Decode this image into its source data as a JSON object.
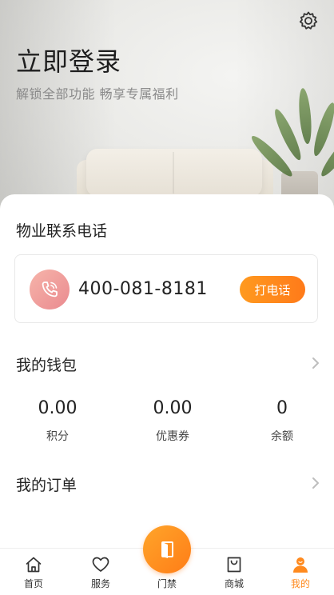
{
  "header": {
    "title": "立即登录",
    "subtitle": "解锁全部功能 畅享专属福利",
    "settings_icon": "gear-icon"
  },
  "property_contact": {
    "title": "物业联系电话",
    "phone_number": "400-081-8181",
    "call_label": "打电话",
    "phone_icon": "phone-icon"
  },
  "wallet": {
    "title": "我的钱包",
    "stats": [
      {
        "value": "0.00",
        "label": "积分"
      },
      {
        "value": "0.00",
        "label": "优惠券"
      },
      {
        "value": "0",
        "label": "余额"
      }
    ]
  },
  "orders": {
    "title": "我的订单"
  },
  "tabbar": {
    "tabs": [
      {
        "label": "首页",
        "icon": "home-icon"
      },
      {
        "label": "服务",
        "icon": "heart-icon"
      },
      {
        "label": "门禁",
        "icon": "door-icon"
      },
      {
        "label": "商城",
        "icon": "shopping-bag-icon"
      },
      {
        "label": "我的",
        "icon": "user-icon"
      }
    ],
    "active_index": 4
  },
  "colors": {
    "accent": "#ff8a1e",
    "phone_circle": "#ef9a98",
    "title_text": "#1e1e1e",
    "subtitle_text": "#8a8a8a"
  }
}
